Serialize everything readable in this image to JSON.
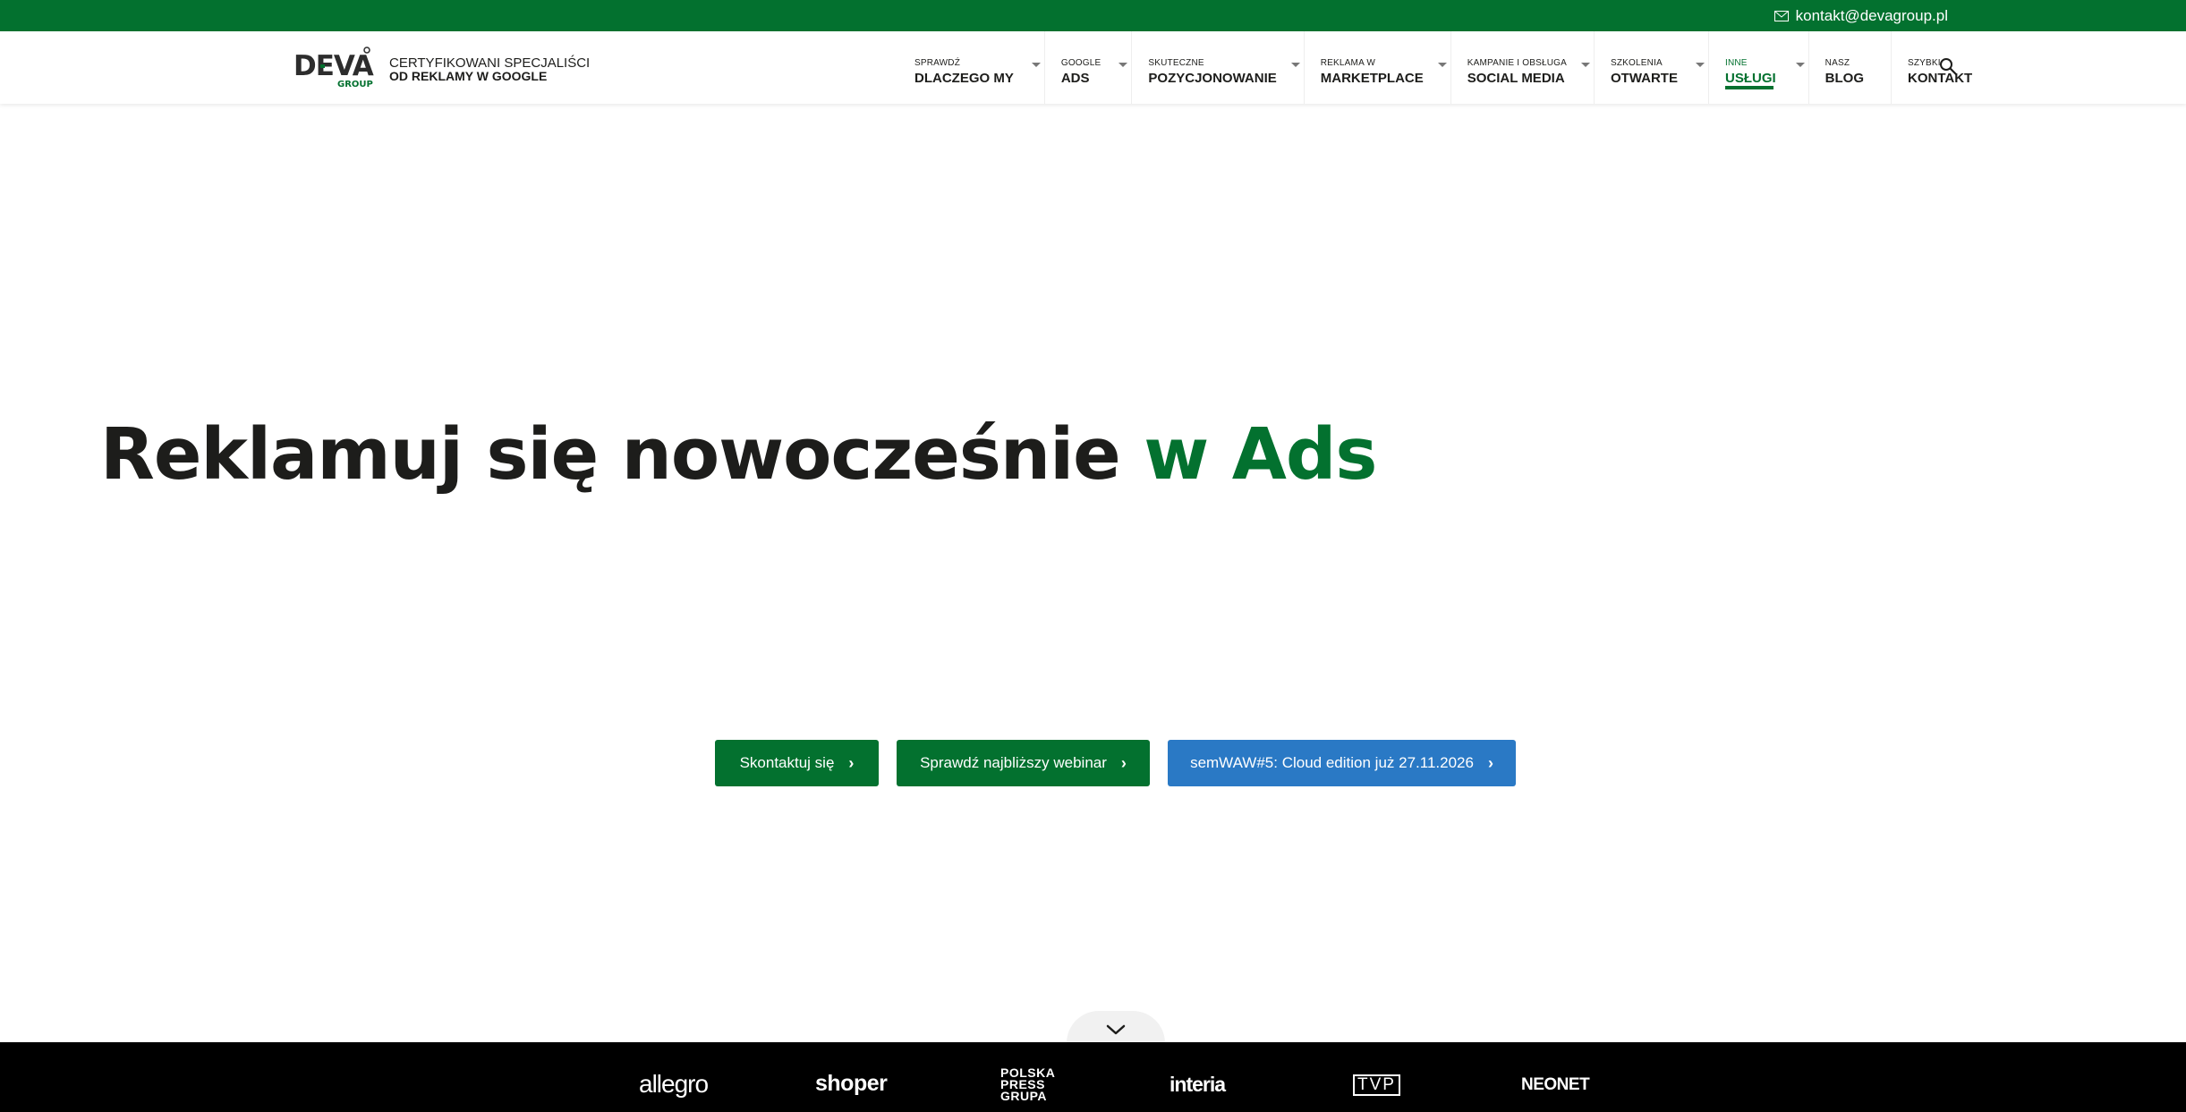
{
  "topbar": {
    "email": "kontakt@devagroup.pl",
    "icon": "mail-icon"
  },
  "header": {
    "logo_text": "DEVA",
    "logo_sub": "GROUP",
    "tagline_line1": "CERTYFIKOWANI SPECJALIŚCI",
    "tagline_line2": "OD REKLAMY W GOOGLE"
  },
  "nav": {
    "items": [
      {
        "small": "SPRAWDŹ",
        "big": "DLACZEGO MY"
      },
      {
        "small": "GOOGLE",
        "big": "ADS"
      },
      {
        "small": "SKUTECZNE",
        "big": "POZYCJONOWANIE"
      },
      {
        "small": "REKLAMA W",
        "big": "MARKETPLACE"
      },
      {
        "small": "KAMPANIE I OBSŁUGA",
        "big": "SOCIAL MEDIA"
      },
      {
        "small": "SZKOLENIA",
        "big": "OTWARTE"
      },
      {
        "small": "INNE",
        "big": "USŁUGI"
      },
      {
        "small": "NASZ",
        "big": "BLOG"
      },
      {
        "small": "SZYBKI",
        "big": "KONTAKT"
      }
    ],
    "active_index": 6,
    "search_icon": "search-icon"
  },
  "hero": {
    "title_main": "Reklamuj się nowocześnie ",
    "title_accent": "w Ads"
  },
  "buttons": {
    "contact": "Skontaktuj się",
    "webinar": "Sprawdź najbliższy webinar",
    "event": "semWAW#5: Cloud edition już 27.11.2026"
  },
  "clients": {
    "allegro": "allegro",
    "shoper": "shoper",
    "polska_1": "POLSKA",
    "polska_2": "PRESS",
    "polska_3": "GRUPA",
    "interia": "interia",
    "tvp": "TVP",
    "neonet": "NEONET"
  },
  "colors": {
    "brand_green": "#03712f",
    "accent_blue": "#2a79c5",
    "text_dark": "#1d1d1b",
    "strip_bg": "#000000"
  }
}
